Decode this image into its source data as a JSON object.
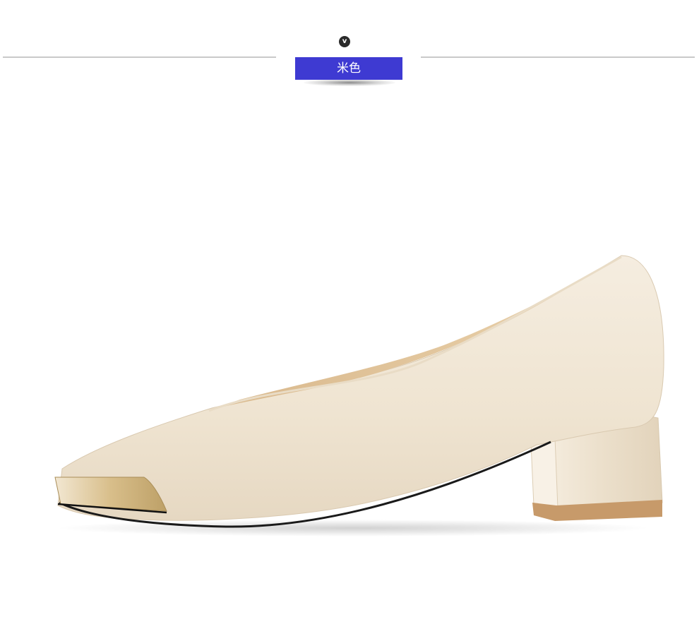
{
  "badge": {
    "glyph": "v",
    "icon": "v-check-icon"
  },
  "color_tag": {
    "label": "米色",
    "background": "#3e3ad2"
  },
  "product": {
    "icon": "beige-pump-shoe",
    "shoe_color": "#efe5d3",
    "lining_color": "#e2c49c",
    "heel_color": "#efe5d3",
    "toe_cap_color": "#c9ab6f"
  }
}
